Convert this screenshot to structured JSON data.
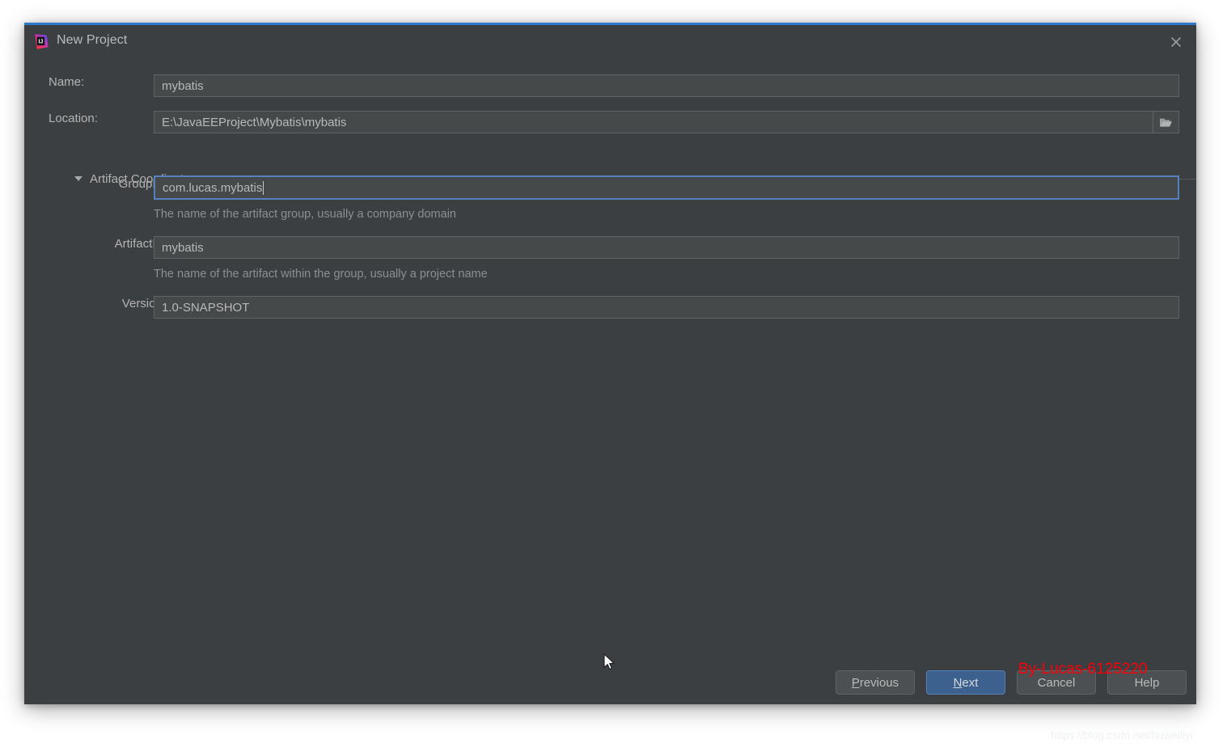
{
  "window": {
    "title": "New Project",
    "app_icon": "intellij-idea-logo-icon",
    "close_icon": "close-icon",
    "accent_color": "#2d79c7",
    "background_color": "#3c3f41"
  },
  "form": {
    "name": {
      "label": "Name:",
      "value": "mybatis"
    },
    "location": {
      "label": "Location:",
      "value": "E:\\JavaEEProject\\Mybatis\\mybatis",
      "browse_icon": "folder-open-icon"
    },
    "group_section": {
      "title": "Artifact Coordinates",
      "expanded": true,
      "toggle_icon": "chevron-down-icon"
    },
    "group_id": {
      "label": "GroupId:",
      "value": "com.lucas.mybatis",
      "hint": "The name of the artifact group, usually a company domain",
      "focused": true
    },
    "artifact_id": {
      "label": "ArtifactId:",
      "value": "mybatis",
      "hint": "The name of the artifact within the group, usually a project name"
    },
    "version": {
      "label": "Version:",
      "value": "1.0-SNAPSHOT"
    }
  },
  "buttons": {
    "previous": {
      "label": "Previous",
      "mnemonic": "P",
      "rest": "revious"
    },
    "next": {
      "label": "Next",
      "mnemonic": "N",
      "rest": "ext",
      "primary": true
    },
    "cancel": {
      "label": "Cancel"
    },
    "help": {
      "label": "Help"
    }
  },
  "watermarks": {
    "author": "By-Lucas-6125220",
    "author_color": "#fb0007",
    "url": "https://blog.csdn.net/huweiliyi"
  }
}
